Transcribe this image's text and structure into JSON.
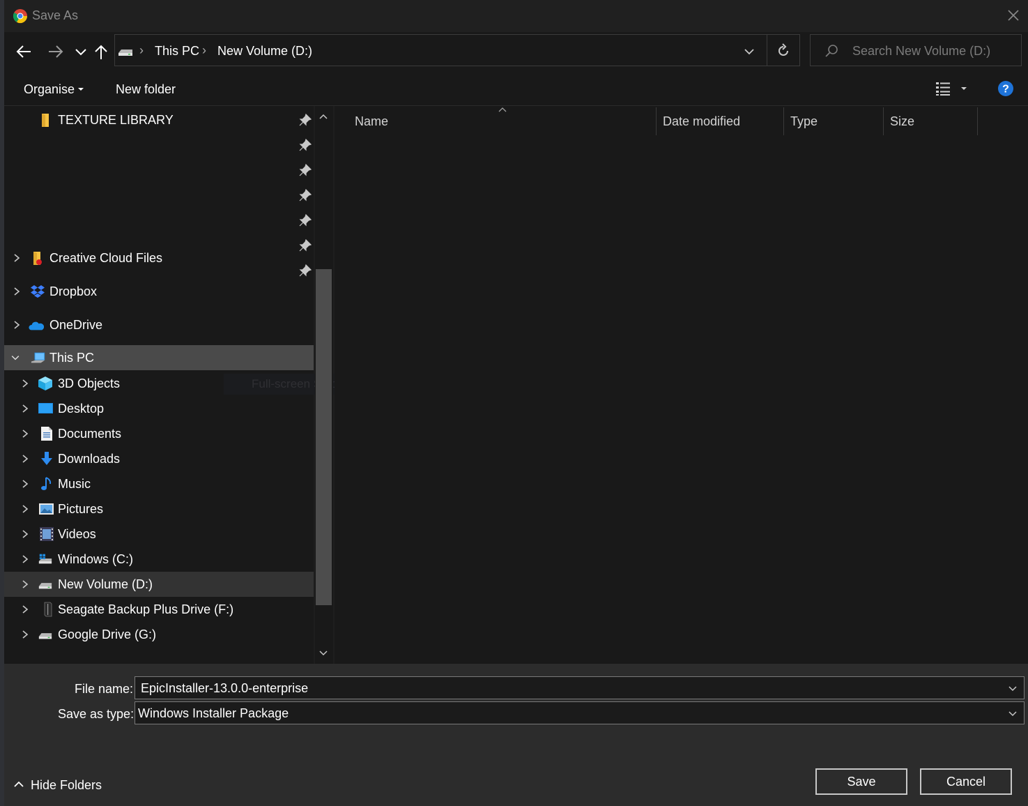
{
  "window": {
    "title": "Save As",
    "close_icon": "close-icon",
    "app_icon": "chrome-icon"
  },
  "nav": {
    "back_icon": "arrow-left-icon",
    "forward_icon": "arrow-right-icon",
    "recent_icon": "chevron-down-icon",
    "up_icon": "arrow-up-icon",
    "breadcrumb": [
      "This PC",
      "New Volume (D:)"
    ],
    "search_placeholder": "Search New Volume (D:)"
  },
  "toolbar": {
    "organise_label": "Organise",
    "new_folder_label": "New folder"
  },
  "sidebar": {
    "items": [
      {
        "label": "TEXTURE LIBRARY",
        "icon": "folder-icon"
      },
      {
        "label": "Creative Cloud Files",
        "icon": "creative-cloud-folder-icon"
      },
      {
        "label": "Dropbox",
        "icon": "dropbox-icon"
      },
      {
        "label": "OneDrive",
        "icon": "onedrive-icon"
      },
      {
        "label": "This PC",
        "icon": "this-pc-icon"
      },
      {
        "label": "3D Objects",
        "icon": "3d-objects-icon"
      },
      {
        "label": "Desktop",
        "icon": "desktop-icon"
      },
      {
        "label": "Documents",
        "icon": "documents-icon"
      },
      {
        "label": "Downloads",
        "icon": "downloads-icon"
      },
      {
        "label": "Music",
        "icon": "music-icon"
      },
      {
        "label": "Pictures",
        "icon": "pictures-icon"
      },
      {
        "label": "Videos",
        "icon": "videos-icon"
      },
      {
        "label": "Windows (C:)",
        "icon": "windows-drive-icon"
      },
      {
        "label": "New Volume (D:)",
        "icon": "drive-icon"
      },
      {
        "label": "Seagate Backup Plus Drive (F:)",
        "icon": "external-drive-icon"
      },
      {
        "label": "Google Drive (G:)",
        "icon": "drive-icon"
      }
    ],
    "tooltip_ghost": "Full-screen Snip"
  },
  "file_list": {
    "columns": [
      "Name",
      "Date modified",
      "Type",
      "Size"
    ]
  },
  "bottom": {
    "file_name_label": "File name:",
    "file_name_value": "EpicInstaller-13.0.0-enterprise",
    "save_type_label": "Save as type:",
    "save_type_value": "Windows Installer Package",
    "hide_folders_label": "Hide Folders",
    "save_label": "Save",
    "cancel_label": "Cancel"
  },
  "colors": {
    "accent": "#1e73d8",
    "background": "#191919",
    "selection": "#4a4a4a"
  }
}
